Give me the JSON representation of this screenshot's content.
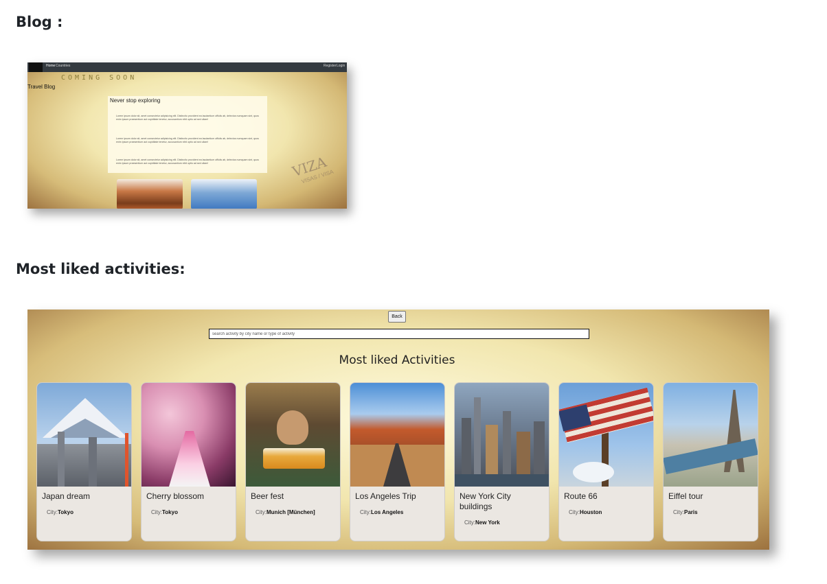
{
  "headings": {
    "blog": "Blog :",
    "liked": "Most liked activities:"
  },
  "blog": {
    "nav": {
      "home": "Home",
      "countries": "Countries",
      "register": "Register",
      "login": "Login"
    },
    "coming_soon": "COMING SOON",
    "page_title": "Travel Blog",
    "card_title": "Never stop exploring",
    "paragraphs": [
      "Lorem ipsum dolor sit, amet consectetur adipisicing elit. Distinctio provident ea laudantium officiis ab, delectus numquam sint, quos enim ipsum praesentium aut cupiditate tenetur, accusantium nihil optio ad sed ullam!",
      "Lorem ipsum dolor sit, amet consectetur adipisicing elit. Distinctio provident ea laudantium officiis ab, delectus numquam sint, quos enim ipsum praesentium aut cupiditate tenetur, accusantium nihil optio ad sed ullam!",
      "Lorem ipsum dolor sit, amet consectetur adipisicing elit. Distinctio provident ea laudantium officiis ab, delectus numquam sint, quos enim ipsum praesentium aut cupiditate tenetur, accusantium nihil optio ad sed ullam!"
    ],
    "stamp": "VIZA",
    "stamp_sub": "VISAS / VISA"
  },
  "activities": {
    "back_label": "Back",
    "search_placeholder": "search activity by city name or type of activity",
    "heading": "Most liked Activities",
    "city_label": "City:",
    "cards": [
      {
        "title": "Japan dream",
        "city": "Tokyo"
      },
      {
        "title": "Cherry blossom",
        "city": "Tokyo"
      },
      {
        "title": "Beer fest",
        "city": "Munich [München]"
      },
      {
        "title": "Los Angeles Trip",
        "city": "Los Angeles"
      },
      {
        "title": "New York City buildings",
        "city": "New York"
      },
      {
        "title": "Route 66",
        "city": "Houston"
      },
      {
        "title": "Eiffel tour",
        "city": "Paris"
      }
    ]
  }
}
